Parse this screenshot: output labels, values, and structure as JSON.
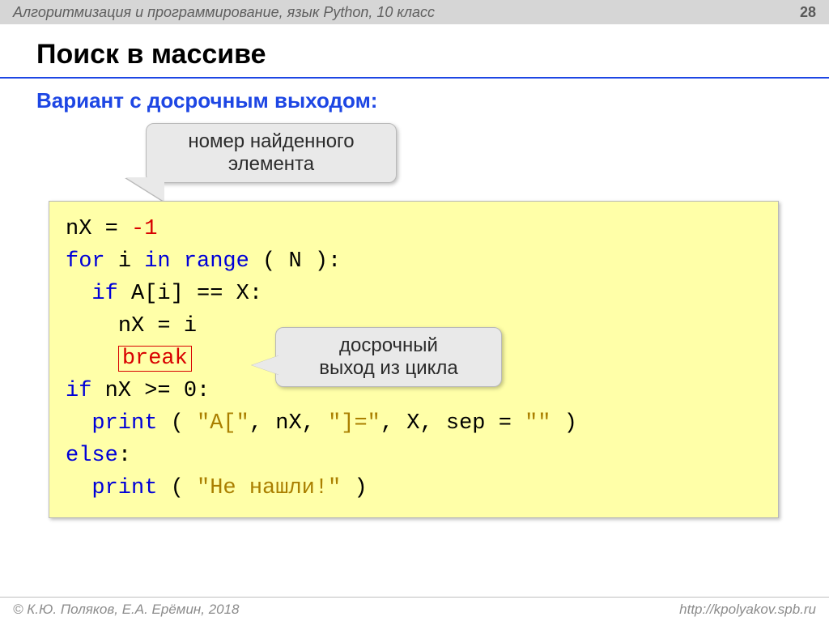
{
  "header": {
    "breadcrumb": "Алгоритмизация и программирование, язык Python, 10 класс",
    "page_number": "28"
  },
  "title": "Поиск в массиве",
  "subtitle": "Вариант с досрочным выходом:",
  "callouts": {
    "found_index": {
      "line1": "номер найденного",
      "line2": "элемента"
    },
    "early_exit": {
      "line1": "досрочный",
      "line2": "выход из цикла"
    }
  },
  "code": {
    "l1a": "nX",
    "l1b": "=",
    "l1c": "-1",
    "l2a": "for",
    "l2b": "i",
    "l2c": "in",
    "l2d": "range",
    "l2e": "( N ):",
    "l3a": "if",
    "l3b": "A[i]",
    "l3c": "==",
    "l3d": "X:",
    "l4a": "nX",
    "l4b": "=",
    "l4c": "i",
    "l5a": "break",
    "l6a": "if",
    "l6b": "nX",
    "l6c": ">=",
    "l6d": "0",
    "l6e": ":",
    "l7a": "print",
    "l7b": "(",
    "l7c": "\"A[\"",
    "l7d": ", nX,",
    "l7e": "\"]=\"",
    "l7f": ", X, sep",
    "l7g": "=",
    "l7h": "\"\"",
    "l7i": ")",
    "l8a": "else",
    "l8b": ":",
    "l9a": "print",
    "l9b": "(",
    "l9c": "\"Не нашли!\"",
    "l9d": ")"
  },
  "footer": {
    "copyright": "© К.Ю. Поляков, Е.А. Ерёмин, 2018",
    "url": "http://kpolyakov.spb.ru"
  }
}
